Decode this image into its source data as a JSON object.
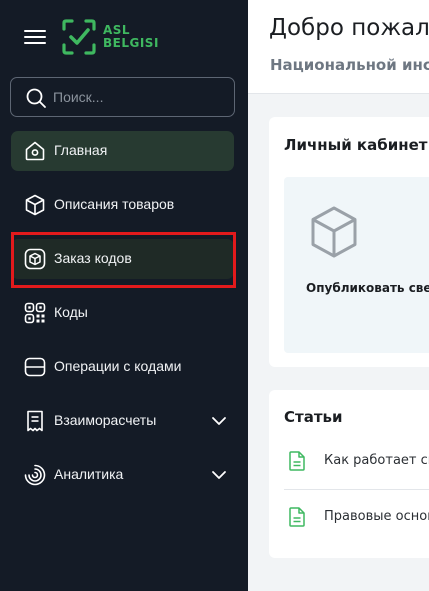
{
  "brand": {
    "line1": "ASL",
    "line2": "BELGISI",
    "accent": "#3fb860"
  },
  "search": {
    "placeholder": "Поиск..."
  },
  "sidebar": {
    "items": [
      {
        "label": "Главная",
        "icon": "home-icon",
        "state": "active"
      },
      {
        "label": "Описания товаров",
        "icon": "box-icon"
      },
      {
        "label": "Заказ кодов",
        "icon": "box-order-icon",
        "state": "highlighted"
      },
      {
        "label": "Коды",
        "icon": "qr-code-icon"
      },
      {
        "label": "Операции с кодами",
        "icon": "operations-icon"
      },
      {
        "label": "Взаиморасчеты",
        "icon": "receipt-icon",
        "expandable": true
      },
      {
        "label": "Аналитика",
        "icon": "analytics-icon",
        "expandable": true
      }
    ]
  },
  "header": {
    "title": "Добро пожал",
    "subtitle": "Национальной инс"
  },
  "cabinet": {
    "title": "Личный кабинет",
    "tile_label": "Опубликовать све"
  },
  "articles": {
    "title": "Статьи",
    "items": [
      {
        "text": "Как работает си"
      },
      {
        "text": "Правовые основ"
      }
    ]
  },
  "colors": {
    "sidebar_bg": "#141b26",
    "active_item_bg": "#273a31",
    "highlight_border": "#e31a1c"
  }
}
